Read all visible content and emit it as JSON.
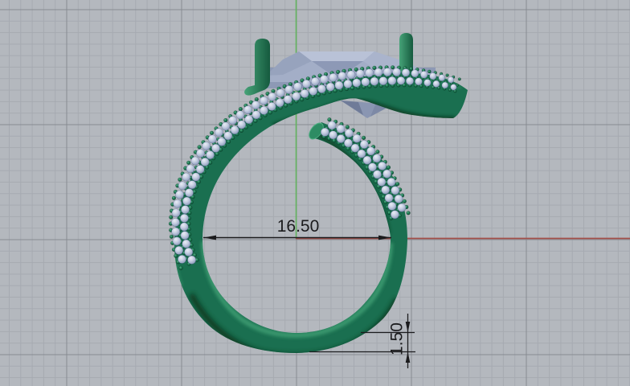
{
  "app": {
    "name": "3d-cad-jewelry-viewport"
  },
  "viewport": {
    "dimensions": {
      "inner_diameter": "16.50",
      "band_thickness": "1.50"
    },
    "colors": {
      "background": "#b4b8be",
      "grid_minor": "#a6aab1",
      "grid_major": "#878b92",
      "axis_vertical": "#64b45f",
      "axis_horizontal": "#a34f49",
      "dimension": "#1b1b1d",
      "band_base": "#1a6f50",
      "band_highlight": "#3f9e73",
      "band_shadow": "#07361f",
      "pave_stone": "#c3cce0",
      "pave_stone_dark": "#7a87a8",
      "pave_bead": "#1d7a54",
      "gem_crown": "#a3aec7",
      "gem_table": "#b9c2d7",
      "gem_girdle": "#8d99b5",
      "gem_pavilion": "#8a96b2",
      "prong_light": "#46a378",
      "prong_dark": "#155a3e"
    },
    "model": {
      "ring": "pave-bypass-ring",
      "gem": "fancy-cut-gemstone"
    }
  }
}
